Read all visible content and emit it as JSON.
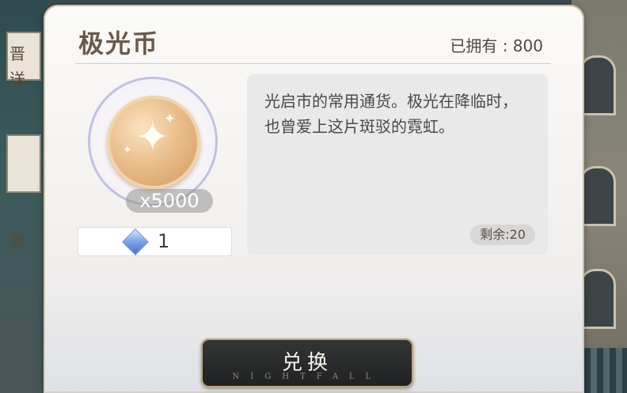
{
  "item": {
    "title": "极光币",
    "owned_label": "已拥有 : 800",
    "quantity_label": "x5000",
    "description": "光启市的常用通货。极光在降临时，也曾爱上这片斑驳的霓虹。",
    "remaining_label": "剩余:20"
  },
  "cost": {
    "icon": "crystal-gem-icon",
    "amount": "1"
  },
  "actions": {
    "exchange_label": "兑换",
    "exchange_subtext": "NIGHTFALL"
  },
  "background_text": {
    "left_tag_1": "晋",
    "left_tag_2": "送",
    "left_tag_3": "朝"
  },
  "colors": {
    "title": "#6a5a4c",
    "button_bg": "#1f2122",
    "button_border": "#c2a57a",
    "coin_gold": "#e9bd8a",
    "ring": "#c4bfe0"
  }
}
